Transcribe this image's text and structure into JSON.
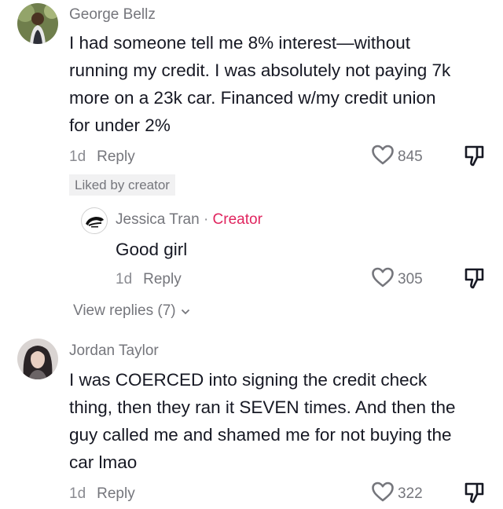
{
  "comments": [
    {
      "username": "George Bellz",
      "text_lines": [
        "I had someone tell me 8% interest—without",
        "running my credit. I was absolutely not paying 7k",
        "more on a 23k car. Financed w/my credit union",
        "for under 2%"
      ],
      "time": "1d",
      "reply_label": "Reply",
      "likes": "845",
      "badge": "Liked by creator",
      "reply": {
        "username": "Jessica Tran",
        "separator": "·",
        "creator_label": "Creator",
        "text": "Good girl",
        "time": "1d",
        "reply_label": "Reply",
        "likes": "305"
      },
      "view_replies": "View replies (7)"
    },
    {
      "username": "Jordan Taylor",
      "text_lines": [
        "I was COERCED into signing the credit check",
        "thing, then they ran it SEVEN times. And then the",
        "guy called me and shamed me for not buying the",
        "car lmao"
      ],
      "time": "1d",
      "reply_label": "Reply",
      "likes": "322"
    }
  ],
  "icons": {
    "like": "heart-outline-icon",
    "dislike": "thumbs-down-outline-icon",
    "expand": "chevron-down-icon"
  },
  "colors": {
    "creator": "#e0245e",
    "muted": "#75767c",
    "text": "#161823",
    "badge_bg": "#f1f1f2"
  }
}
